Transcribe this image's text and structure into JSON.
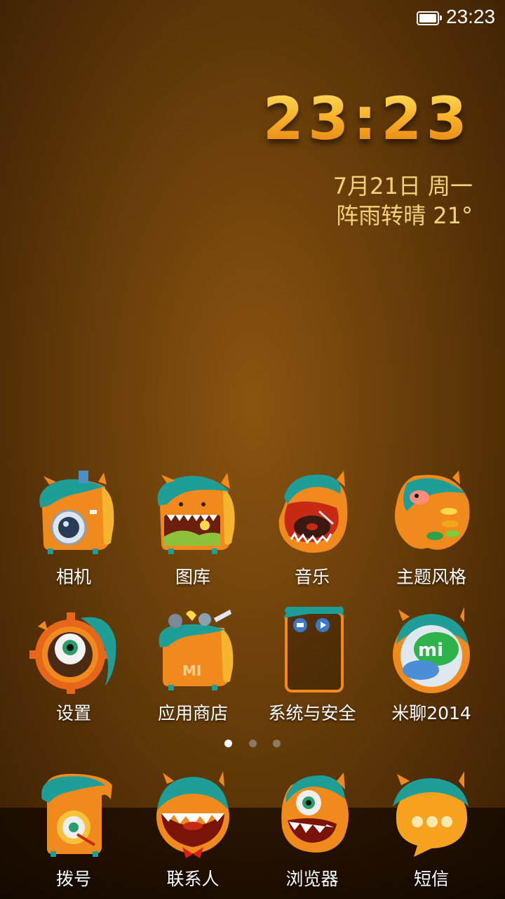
{
  "status": {
    "time": "23:23",
    "battery_icon": "battery-icon"
  },
  "widget": {
    "clock": "23:23",
    "date": "7月21日 周一",
    "weather": "阵雨转晴  21°"
  },
  "apps_row1": [
    {
      "label": "相机",
      "icon": "camera-monster-icon"
    },
    {
      "label": "图库",
      "icon": "gallery-monster-icon"
    },
    {
      "label": "音乐",
      "icon": "music-monster-icon"
    },
    {
      "label": "主题风格",
      "icon": "theme-monster-icon"
    }
  ],
  "apps_row2": [
    {
      "label": "设置",
      "icon": "settings-monster-icon"
    },
    {
      "label": "应用商店",
      "icon": "app-store-monster-icon"
    },
    {
      "label": "系统与安全",
      "icon": "folder-icon"
    },
    {
      "label": "米聊2014",
      "icon": "miliao-monster-icon"
    }
  ],
  "page_indicator": {
    "pages": 3,
    "current": 1
  },
  "dock": [
    {
      "label": "拨号",
      "icon": "phone-monster-icon"
    },
    {
      "label": "联系人",
      "icon": "contacts-monster-icon"
    },
    {
      "label": "浏览器",
      "icon": "browser-monster-icon"
    },
    {
      "label": "短信",
      "icon": "messages-monster-icon"
    }
  ],
  "colors": {
    "background": "#6b3f0a",
    "clock_gold": "#f9b52a",
    "date_text": "#f4d27a",
    "monster_teal": "#1f9e98",
    "monster_orange": "#f08a1c"
  }
}
